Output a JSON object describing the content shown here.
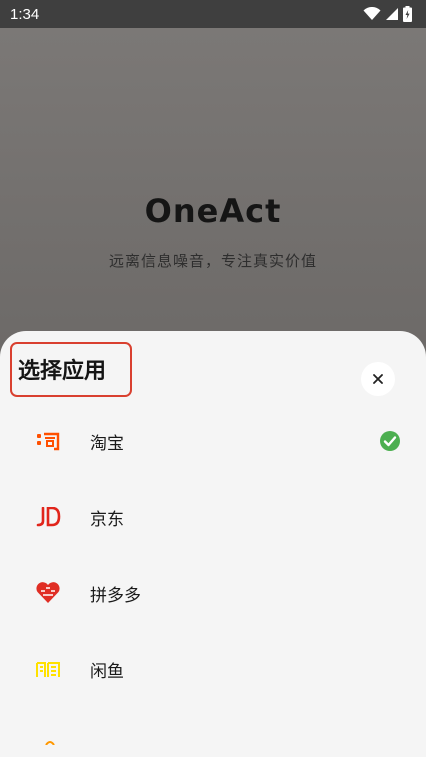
{
  "status_bar": {
    "time": "1:34",
    "icons": [
      "wifi-icon",
      "cellular-icon",
      "battery-charging-icon"
    ]
  },
  "background": {
    "title": "OneAct",
    "slogan": "远离信息噪音，专注真实价值"
  },
  "sheet": {
    "title": "选择应用",
    "close_icon": "close-icon",
    "highlight_color": "#d9402f",
    "apps": [
      {
        "label": "淘宝",
        "icon": "taobao-icon",
        "selected": true
      },
      {
        "label": "京东",
        "icon": "jd-icon",
        "selected": false
      },
      {
        "label": "拼多多",
        "icon": "pinduoduo-icon",
        "selected": false
      },
      {
        "label": "闲鱼",
        "icon": "xianyu-icon",
        "selected": false
      }
    ],
    "check_color": "#4caf50"
  }
}
